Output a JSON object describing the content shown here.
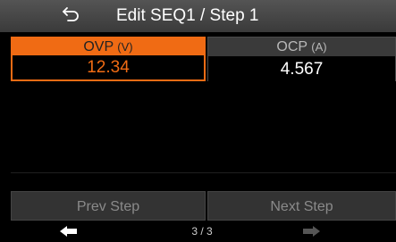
{
  "header": {
    "title": "Edit SEQ1 / Step 1",
    "back_icon": "back-arrow-icon"
  },
  "params": [
    {
      "name": "OVP",
      "unit": "(V)",
      "value": "12.34",
      "selected": true
    },
    {
      "name": "OCP",
      "unit": "(A)",
      "value": "4.567",
      "selected": false
    }
  ],
  "steps": {
    "prev_label": "Prev Step",
    "next_label": "Next Step"
  },
  "footer": {
    "page": "3 / 3",
    "left_icon": "arrow-left-icon",
    "right_icon": "arrow-right-icon"
  },
  "colors": {
    "accent": "#f06b14",
    "header": "#4a4a4a",
    "button": "#333333",
    "disabled_arrow": "#555555"
  }
}
